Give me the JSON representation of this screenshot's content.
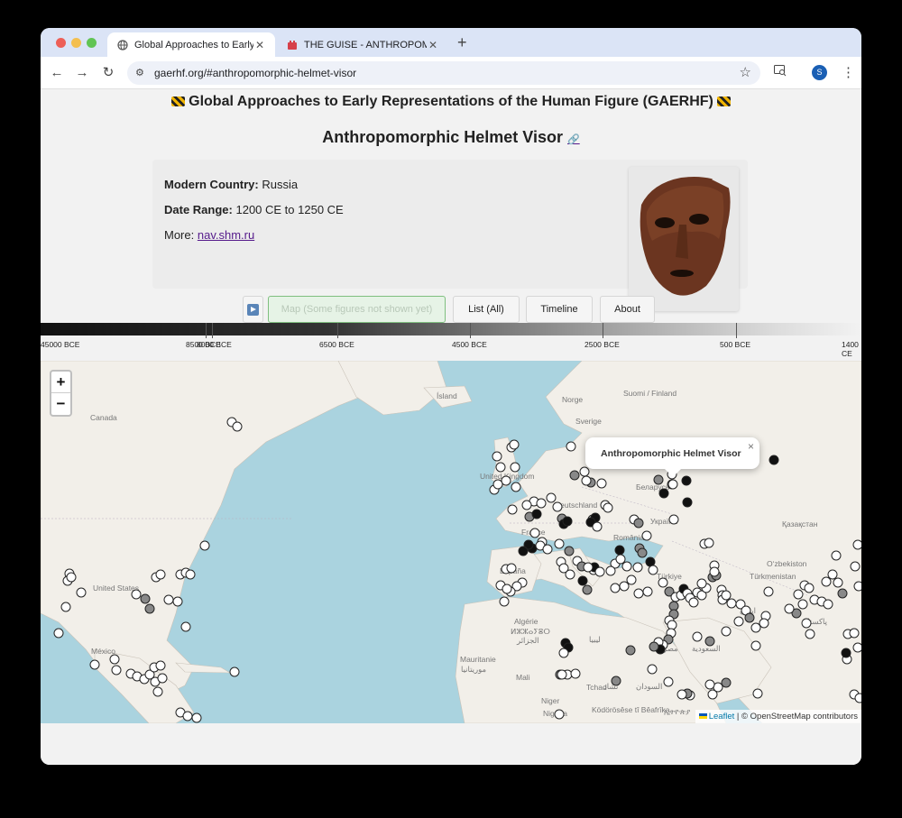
{
  "browser": {
    "tabs": [
      {
        "title": "Global Approaches to Early R",
        "active": true
      },
      {
        "title": "THE GUISE - ANTHROPOMO",
        "active": false
      }
    ],
    "new_tab": "+",
    "url": "gaerhf.org/#anthropomorphic-helmet-visor",
    "profile_initial": "S"
  },
  "page": {
    "site_title": "Global Approaches to Early Representations of the Human Figure (GAERHF)",
    "figure_title": "Anthropomorphic Helmet Visor",
    "permalink_icon": "🔗",
    "country_label": "Modern Country:",
    "country_value": "Russia",
    "date_label": "Date Range:",
    "date_value": "1200 CE to 1250 CE",
    "more_label": "More:",
    "more_link": "nav.shm.ru"
  },
  "nav": {
    "map": "Map (Some figures not shown yet)",
    "list": "List (All)",
    "timeline": "Timeline",
    "about": "About"
  },
  "timeline": {
    "ticks": [
      "45000 BCE",
      "8500 BCE",
      "8000 BCE",
      "6500 BCE",
      "4500 BCE",
      "2500 BCE",
      "500 BCE",
      "1400 CE"
    ]
  },
  "map": {
    "zoom_in": "+",
    "zoom_out": "−",
    "popup_title": "Anthropomorphic Helmet Visor",
    "popup_close": "×",
    "attribution_leaflet": "Leaflet",
    "attribution_rest": " | © OpenStreetMap contributors",
    "labels": [
      "Ísland",
      "Norge",
      "Suomi / Finland",
      "Sverige",
      "Canada",
      "United Kingdom",
      "Deutschland",
      "Беларусь",
      "Україна",
      "Қазақстан",
      "France",
      "România",
      "España",
      "Türkiye",
      "Türkmenistan",
      "O‘zbekiston",
      "United States",
      "Algérie",
      "ⵍⵣⵣⴰⵢⴻⵔ",
      "الجزائر",
      "ليبيا",
      "مصر",
      "السعودية",
      "ایران",
      "پاکستان",
      "México",
      "Mauritanie",
      "موريتانيا",
      "Mali",
      "Tchad",
      "تشاد",
      "السودان",
      "Niger",
      "Nigeria",
      "Ködörösêse tî Bêafrîka",
      "ኢትዮጵያ"
    ]
  }
}
